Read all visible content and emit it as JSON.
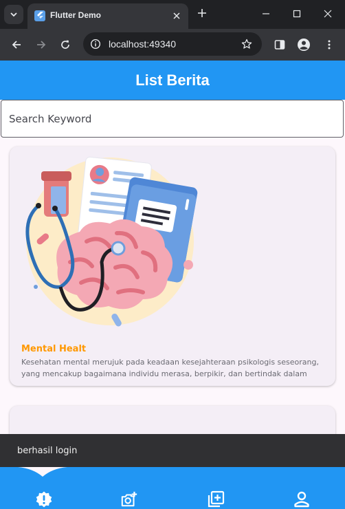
{
  "browser": {
    "tab_title": "Flutter Demo",
    "url": "localhost:49340",
    "icons": {
      "tab_search": "chevron-down-icon",
      "favicon": "flutter-icon",
      "close": "close-icon",
      "new_tab": "plus-icon",
      "back": "arrow-left-icon",
      "forward": "arrow-right-icon",
      "reload": "reload-icon",
      "site_info": "site-info-icon",
      "bookmark": "star-icon",
      "side_panel": "side-panel-icon",
      "profile": "profile-icon",
      "menu": "more-vert-icon",
      "minimize": "minimize-icon",
      "maximize": "maximize-icon",
      "window_close": "window-close-icon"
    }
  },
  "app": {
    "title": "List Berita",
    "search": {
      "placeholder": "Search Keyword",
      "value": ""
    },
    "news": [
      {
        "title": "Mental Healt",
        "description": "Kesehatan mental merujuk pada keadaan kesejahteraan psikologis seseorang, yang mencakup bagaimana individu merasa, berpikir, dan bertindak dalam"
      }
    ],
    "snackbar": "berhasil login",
    "bottom_nav": {
      "items": [
        {
          "icon": "alert-badge-icon"
        },
        {
          "icon": "add-photo-icon"
        },
        {
          "icon": "add-box-icon"
        },
        {
          "icon": "person-icon"
        }
      ]
    }
  },
  "colors": {
    "primary": "#2196f3",
    "title_accent": "#ff9800",
    "background": "#fdf7fc",
    "card": "#f4eef6",
    "snackbar": "#303033"
  }
}
